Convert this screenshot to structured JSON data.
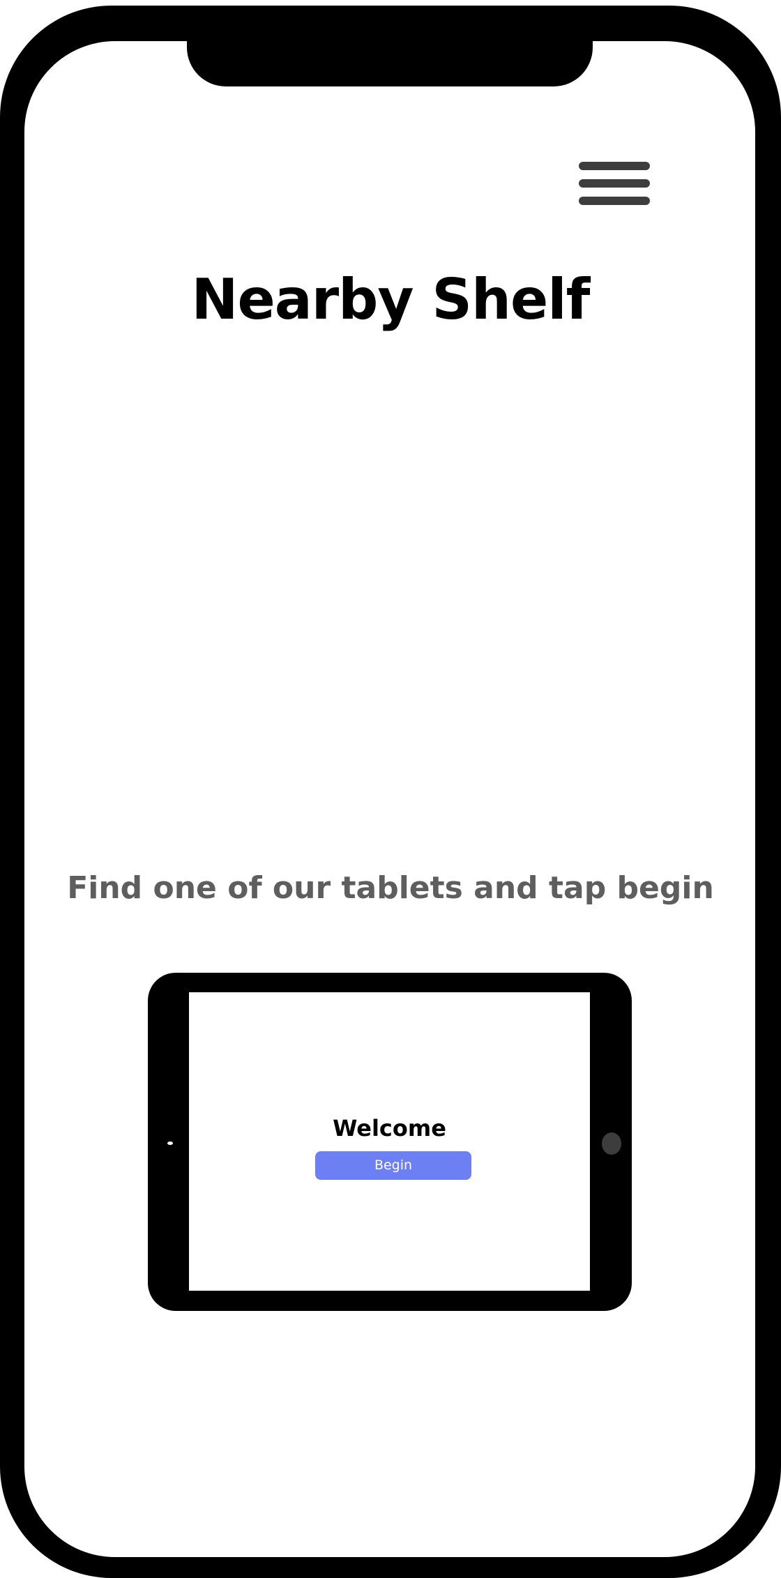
{
  "app": {
    "title": "Nearby Shelf"
  },
  "header": {
    "menu_icon": "hamburger-menu-icon"
  },
  "main": {
    "instruction": "Find one of our tablets and tap begin"
  },
  "tablet": {
    "welcome_title": "Welcome",
    "begin_label": "Begin"
  },
  "colors": {
    "frame": "#000000",
    "screen": "#ffffff",
    "menu_icon": "#3d3d3d",
    "instruction_text": "#5e5e5e",
    "begin_button": "#6d80f3",
    "begin_button_text": "#ffffff"
  }
}
